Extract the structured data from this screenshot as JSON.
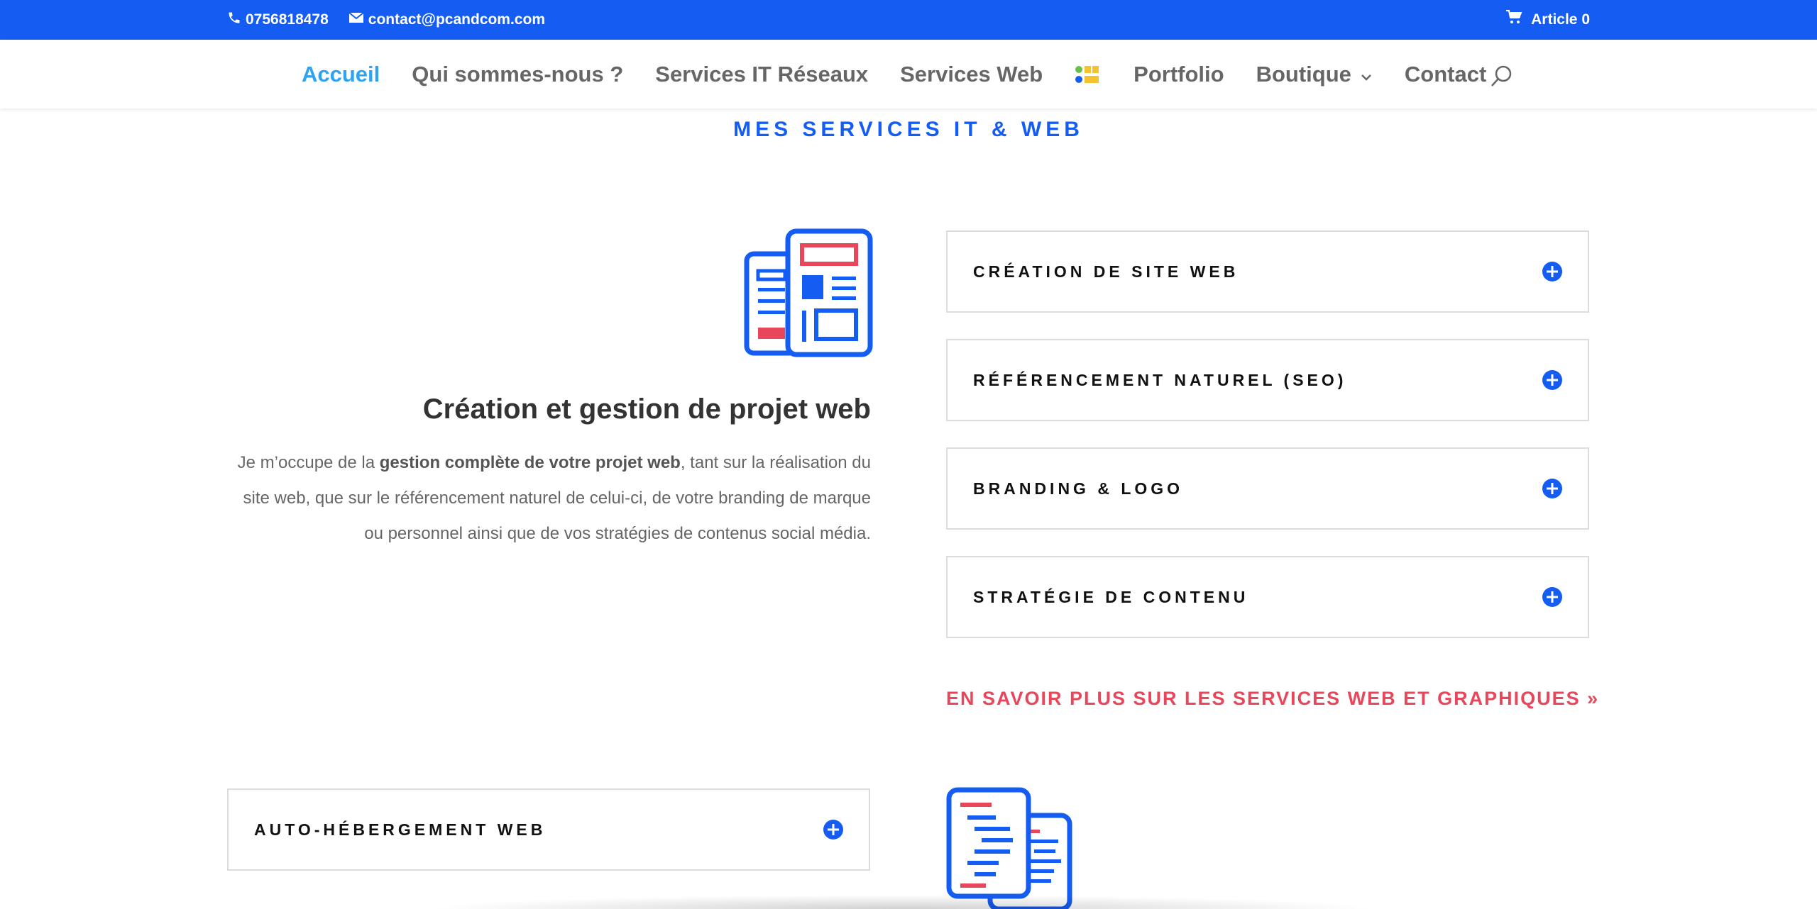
{
  "topbar": {
    "phone": "0756818478",
    "email": "contact@pcandcom.com",
    "cart": "Article 0"
  },
  "nav": {
    "items": [
      {
        "label": "Accueil",
        "active": true
      },
      {
        "label": "Qui sommes-nous ?"
      },
      {
        "label": "Services IT Réseaux"
      },
      {
        "label": "Services Web"
      },
      {
        "label": "Portfolio"
      },
      {
        "label": "Boutique",
        "has_dropdown": true
      },
      {
        "label": "Contact"
      }
    ],
    "search_icon": "search-icon"
  },
  "section": {
    "title": "MES SERVICES IT & WEB"
  },
  "feature": {
    "heading": "Création et gestion de projet web",
    "text_before": "Je m’occupe de la ",
    "text_bold": "gestion complète de votre projet web",
    "text_after": ", tant sur la réalisation du site web, que sur le référencement naturel de celui-ci, de votre branding de marque ou personnel ainsi que de vos stratégies de contenus social média."
  },
  "accordion": [
    {
      "label": "CRÉATION DE SITE WEB"
    },
    {
      "label": "RÉFÉRENCEMENT NATUREL (SEO)"
    },
    {
      "label": "BRANDING & LOGO"
    },
    {
      "label": "STRATÉGIE DE CONTENU"
    }
  ],
  "more_link": "EN SAVOIR PLUS SUR LES SERVICES WEB ET GRAPHIQUES »",
  "accordion_bottom": {
    "label": "AUTO-HÉBERGEMENT WEB"
  },
  "colors": {
    "brand_blue": "#155cf2",
    "active_link": "#2ea3f2",
    "accent_red": "#e8465a"
  }
}
